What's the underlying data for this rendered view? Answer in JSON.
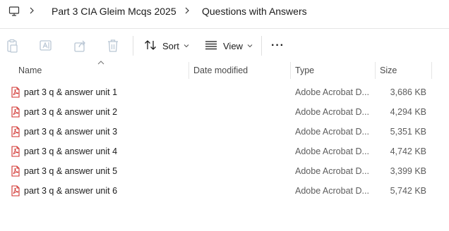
{
  "breadcrumb": {
    "icon": "monitor-icon",
    "items": [
      "Part 3 CIA Gleim Mcqs 2025",
      "Questions with Answers"
    ]
  },
  "toolbar": {
    "sort_label": "Sort",
    "view_label": "View",
    "more_label": "···"
  },
  "columns": {
    "name": "Name",
    "date_modified": "Date modified",
    "type": "Type",
    "size": "Size"
  },
  "files": [
    {
      "name": "part 3 q & answer unit 1",
      "date": "",
      "type": "Adobe Acrobat D...",
      "size": "3,686 KB"
    },
    {
      "name": "part 3 q & answer unit 2",
      "date": "",
      "type": "Adobe Acrobat D...",
      "size": "4,294 KB"
    },
    {
      "name": "part 3 q & answer unit 3",
      "date": "",
      "type": "Adobe Acrobat D...",
      "size": "5,351 KB"
    },
    {
      "name": "part 3 q & answer unit 4",
      "date": "",
      "type": "Adobe Acrobat D...",
      "size": "4,742 KB"
    },
    {
      "name": "part 3 q & answer unit 5",
      "date": "",
      "type": "Adobe Acrobat D...",
      "size": "3,399 KB"
    },
    {
      "name": "part 3 q & answer unit 6",
      "date": "",
      "type": "Adobe Acrobat D...",
      "size": "5,742 KB"
    }
  ],
  "colors": {
    "pdf_red": "#d0312d",
    "disabled_icon": "#b9c6d4",
    "text": "#1b1b1b"
  }
}
